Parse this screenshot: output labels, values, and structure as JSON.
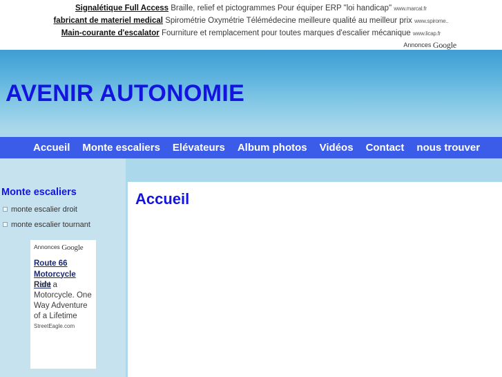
{
  "top_ads": {
    "label": "Annonces",
    "brand": "Google",
    "items": [
      {
        "title": "Signalétique Full Access",
        "desc": "Braille, relief et pictogrammes Pour équiper ERP \"loi handicap\"",
        "url": "www.marcal.fr"
      },
      {
        "title": "fabricant de materiel medical",
        "desc": "Spirométrie Oxymétrie Télémédecine meilleure qualité au meilleur prix",
        "url": "www.spirome.."
      },
      {
        "title": "Main-courante d'escalator",
        "desc": "Fourniture et remplacement pour toutes marques d'escalier mécanique",
        "url": "www.licap.fr"
      }
    ]
  },
  "header": {
    "site_title": "AVENIR AUTONOMIE"
  },
  "nav": {
    "items": [
      {
        "label": "Accueil"
      },
      {
        "label": "Monte escaliers"
      },
      {
        "label": "Elévateurs"
      },
      {
        "label": "Album photos"
      },
      {
        "label": "Vidéos"
      },
      {
        "label": "Contact"
      },
      {
        "label": "nous trouver"
      }
    ]
  },
  "sidebar": {
    "title": "Monte escaliers",
    "links": [
      {
        "label": "monte escalier droit"
      },
      {
        "label": "monte escalier tournant"
      }
    ],
    "ad": {
      "label": "Annonces",
      "brand": "Google",
      "link": "Route 66 Motorcycle Ride",
      "desc": "Rent a Motorcycle. One Way Adventure of a Lifetime",
      "url": "StreetEagle.com"
    }
  },
  "main": {
    "page_title": "Accueil"
  },
  "colors": {
    "nav_background": "#3b5ce8",
    "title_blue": "#1414e0",
    "sidebar_background": "#c5e2ee",
    "body_background": "#abd8ea",
    "header_gradient_top": "#3f9dd2",
    "header_gradient_bottom": "#abd8ea"
  }
}
